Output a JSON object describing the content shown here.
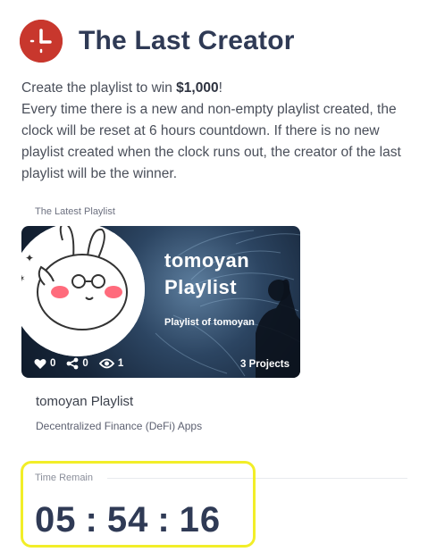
{
  "header": {
    "logo_icon": "clock-icon",
    "title": "The Last Creator",
    "accent_color": "#c8372d"
  },
  "intro": {
    "line1_prefix": "Create the playlist to win ",
    "line1_prize": "$1,000",
    "line1_suffix": "!",
    "body": "Every time there is a new and non-empty playlist created, the clock will be reset at 6 hours countdown. If there is no new playlist created when the clock runs out, the creator of the last playlist will be the winner."
  },
  "latest": {
    "label": "The Latest Playlist",
    "card": {
      "title": "tomoyan Playlist",
      "subtitle": "Playlist of tomoyan",
      "likes": "0",
      "shares": "0",
      "views": "1",
      "projects": "3 Projects"
    },
    "name": "tomoyan Playlist",
    "category": "Decentralized Finance (DeFi) Apps"
  },
  "timer": {
    "label": "Time Remain",
    "hours": "05",
    "minutes": "54",
    "seconds": "16",
    "separator": ":"
  }
}
